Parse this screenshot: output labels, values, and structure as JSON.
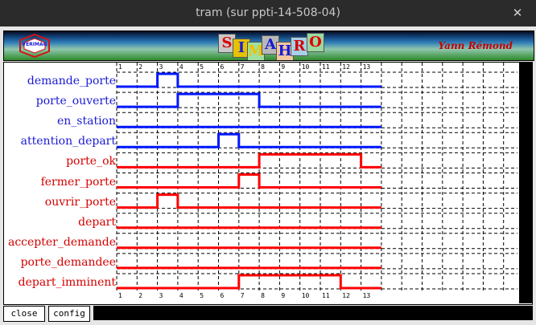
{
  "window": {
    "title": "tram (sur ppti-14-508-04)",
    "close_glyph": "✕"
  },
  "banner": {
    "logo_text": "VERIMAG",
    "title_letters": [
      "S",
      "I",
      "M",
      "A",
      "H",
      "R",
      "O"
    ],
    "author": "Yann Rémond",
    "colors": {
      "logo": "#1a1adb",
      "author": "#c70000"
    }
  },
  "chronogram": {
    "step_numbers": [
      "1",
      "2",
      "3",
      "4",
      "5",
      "6",
      "7",
      "8",
      "9",
      "10",
      "11",
      "12",
      "13"
    ],
    "colors": {
      "input": "#1a1ad4",
      "output": "#d40000",
      "signal_in": "#0018ff",
      "signal_out": "#ff0000"
    },
    "signals": [
      {
        "name": "demande_porte",
        "kind": "input",
        "levels": [
          0,
          0,
          1,
          0,
          0,
          0,
          0,
          0,
          0,
          0,
          0,
          0,
          0
        ]
      },
      {
        "name": "porte_ouverte",
        "kind": "input",
        "levels": [
          0,
          0,
          0,
          1,
          1,
          1,
          1,
          0,
          0,
          0,
          0,
          0,
          0
        ]
      },
      {
        "name": "en_station",
        "kind": "input",
        "levels": [
          0,
          0,
          0,
          0,
          0,
          0,
          0,
          0,
          0,
          0,
          0,
          0,
          0
        ]
      },
      {
        "name": "attention_depart",
        "kind": "input",
        "levels": [
          0,
          0,
          0,
          0,
          0,
          1,
          0,
          0,
          0,
          0,
          0,
          0,
          0
        ]
      },
      {
        "name": "porte_ok",
        "kind": "output",
        "levels": [
          0,
          0,
          0,
          0,
          0,
          0,
          0,
          1,
          1,
          1,
          1,
          1,
          0
        ]
      },
      {
        "name": "fermer_porte",
        "kind": "output",
        "levels": [
          0,
          0,
          0,
          0,
          0,
          0,
          1,
          0,
          0,
          0,
          0,
          0,
          0
        ]
      },
      {
        "name": "ouvrir_porte",
        "kind": "output",
        "levels": [
          0,
          0,
          1,
          0,
          0,
          0,
          0,
          0,
          0,
          0,
          0,
          0,
          0
        ]
      },
      {
        "name": "depart",
        "kind": "output",
        "levels": [
          0,
          0,
          0,
          0,
          0,
          0,
          0,
          0,
          0,
          0,
          0,
          0,
          0
        ]
      },
      {
        "name": "accepter_demande",
        "kind": "output",
        "levels": [
          0,
          0,
          0,
          0,
          0,
          0,
          0,
          0,
          0,
          0,
          0,
          0,
          0
        ]
      },
      {
        "name": "porte_demandee",
        "kind": "output",
        "levels": [
          0,
          0,
          0,
          0,
          0,
          0,
          0,
          0,
          0,
          0,
          0,
          0,
          0
        ]
      },
      {
        "name": "depart_imminent",
        "kind": "output",
        "levels": [
          0,
          0,
          0,
          0,
          0,
          0,
          1,
          1,
          1,
          1,
          1,
          0,
          0
        ]
      }
    ]
  },
  "footer": {
    "close_label": "close",
    "config_label": "config"
  }
}
